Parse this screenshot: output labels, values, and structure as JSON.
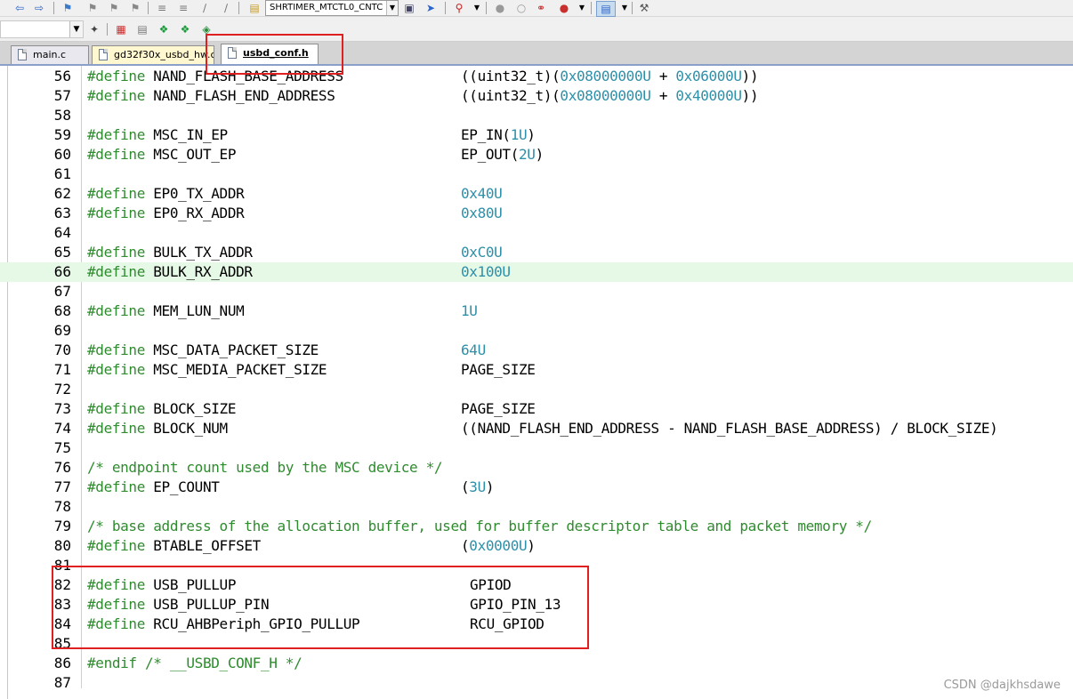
{
  "toolbar": {
    "function_combo": "SHRTIMER_MTCTL0_CNTC",
    "icons_row1": [
      "back-arrow-icon",
      "forward-arrow-icon",
      "bookmark-icon",
      "bookmark-prev-icon",
      "bookmark-next-icon",
      "bookmark-clear-icon",
      "indent-icon",
      "outdent-icon",
      "comment-icon",
      "uncomment-icon",
      "find-in-files-icon",
      "debug-session-icon",
      "run-icon",
      "stop-icon",
      "breakpoint-icon",
      "insert-breakpoint-icon",
      "enable-breakpoint-icon",
      "clear-breakpoints-icon",
      "window-icon",
      "settings-wrench-icon"
    ],
    "icons_row2": [
      "magic-wand-icon",
      "load-icon",
      "download-icon",
      "build-icon",
      "rebuild-icon",
      "batch-build-icon"
    ]
  },
  "tabs": [
    {
      "label": "main.c",
      "active": false
    },
    {
      "label": "gd32f30x_usbd_hw.c",
      "active": false
    },
    {
      "label": "usbd_conf.h",
      "active": true
    }
  ],
  "editor": {
    "lines": [
      {
        "n": "56",
        "kw": "#define",
        "name": " NAND_FLASH_BASE_ADDRESS",
        "value": "((uint32_t)(0x08000000U + 0x06000U))"
      },
      {
        "n": "57",
        "kw": "#define",
        "name": " NAND_FLASH_END_ADDRESS",
        "value": "((uint32_t)(0x08000000U + 0x40000U))"
      },
      {
        "n": "58"
      },
      {
        "n": "59",
        "kw": "#define",
        "name": " MSC_IN_EP",
        "value": "EP_IN(1U)"
      },
      {
        "n": "60",
        "kw": "#define",
        "name": " MSC_OUT_EP",
        "value": "EP_OUT(2U)"
      },
      {
        "n": "61"
      },
      {
        "n": "62",
        "kw": "#define",
        "name": " EP0_TX_ADDR",
        "value": "0x40U"
      },
      {
        "n": "63",
        "kw": "#define",
        "name": " EP0_RX_ADDR",
        "value": "0x80U"
      },
      {
        "n": "64"
      },
      {
        "n": "65",
        "kw": "#define",
        "name": " BULK_TX_ADDR",
        "value": "0xC0U"
      },
      {
        "n": "66",
        "kw": "#define",
        "name": " BULK_RX_ADDR",
        "value": "0x100U",
        "highlight": true
      },
      {
        "n": "67"
      },
      {
        "n": "68",
        "kw": "#define",
        "name": " MEM_LUN_NUM",
        "value": "1U"
      },
      {
        "n": "69"
      },
      {
        "n": "70",
        "kw": "#define",
        "name": " MSC_DATA_PACKET_SIZE",
        "value": "64U"
      },
      {
        "n": "71",
        "kw": "#define",
        "name": " MSC_MEDIA_PACKET_SIZE",
        "value": "PAGE_SIZE"
      },
      {
        "n": "72"
      },
      {
        "n": "73",
        "kw": "#define",
        "name": " BLOCK_SIZE",
        "value": "PAGE_SIZE"
      },
      {
        "n": "74",
        "kw": "#define",
        "name": " BLOCK_NUM",
        "value": "((NAND_FLASH_END_ADDRESS - NAND_FLASH_BASE_ADDRESS) / BLOCK_SIZE)"
      },
      {
        "n": "75"
      },
      {
        "n": "76",
        "comment": "/* endpoint count used by the MSC device */"
      },
      {
        "n": "77",
        "kw": "#define",
        "name": " EP_COUNT",
        "value": "(3U)"
      },
      {
        "n": "78"
      },
      {
        "n": "79",
        "comment": "/* base address of the allocation buffer, used for buffer descriptor table and packet memory */"
      },
      {
        "n": "80",
        "kw": "#define",
        "name": " BTABLE_OFFSET",
        "value": "(0x0000U)"
      },
      {
        "n": "81"
      },
      {
        "n": "82",
        "kw": "#define",
        "name": " USB_PULLUP",
        "value": "GPIOD",
        "shift": true
      },
      {
        "n": "83",
        "kw": "#define",
        "name": " USB_PULLUP_PIN",
        "value": "GPIO_PIN_13",
        "shift": true
      },
      {
        "n": "84",
        "kw": "#define",
        "name": " RCU_AHBPeriph_GPIO_PULLUP",
        "value": "RCU_GPIOD",
        "shift": true
      },
      {
        "n": "85"
      },
      {
        "n": "86",
        "kw": "#endif",
        "name": " /* __USBD_CONF_H */",
        "value": ""
      },
      {
        "n": "87"
      }
    ]
  },
  "watermark": "CSDN @dajkhsdawe",
  "colors": {
    "keyword": "#2e8b2e",
    "number": "#2e8fa8",
    "highlight_line": "#e6f8e6",
    "annotation": "#e02020"
  }
}
